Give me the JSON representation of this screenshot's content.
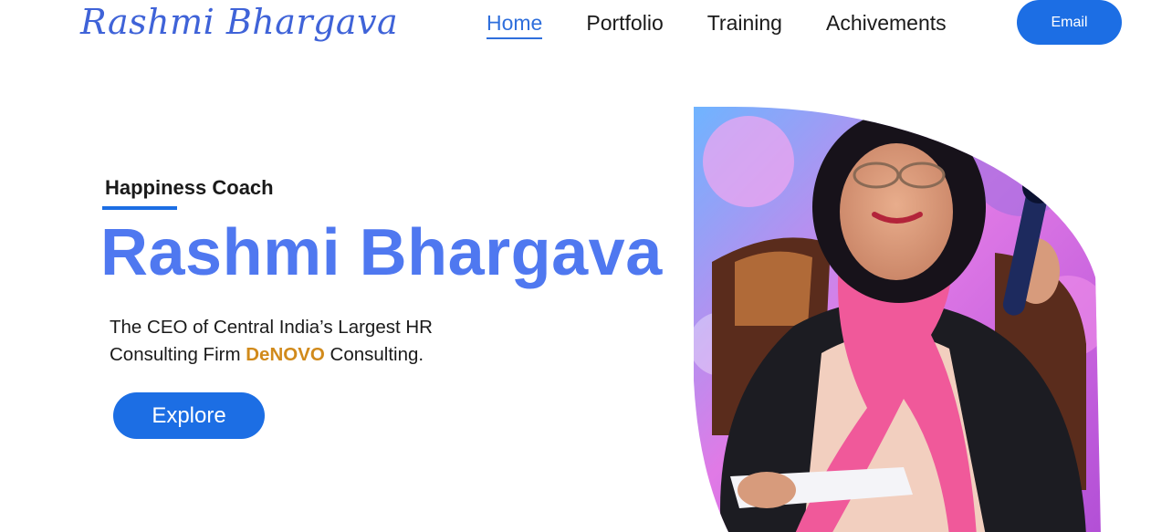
{
  "header": {
    "logo_text": "Rashmi Bhargava",
    "nav": [
      {
        "label": "Home",
        "active": true
      },
      {
        "label": "Portfolio",
        "active": false
      },
      {
        "label": "Training",
        "active": false
      },
      {
        "label": "Achivements",
        "active": false
      }
    ],
    "email_label": "Email"
  },
  "hero": {
    "eyebrow": "Happiness Coach",
    "name": "Rashmi Bhargava",
    "desc_line1": "The CEO of Central India’s Largest HR",
    "desc_line2_prefix": "Consulting Firm ",
    "desc_brand": "DeNOVO",
    "desc_line2_suffix": " Consulting.",
    "explore_label": "Explore"
  },
  "colors": {
    "accent": "#1c6ee4",
    "name_color": "#4f78f0",
    "brand_color": "#d18a1b"
  }
}
